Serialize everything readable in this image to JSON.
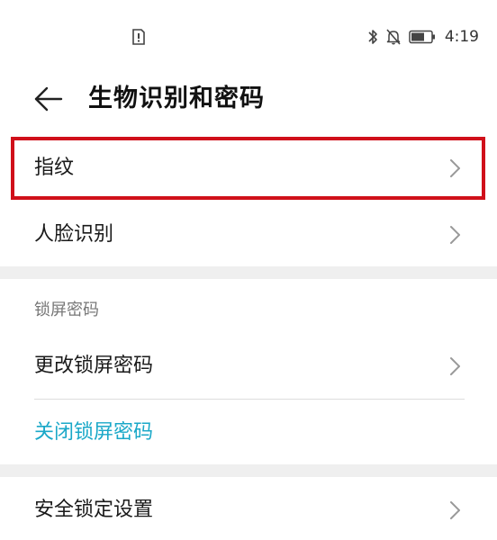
{
  "status_bar": {
    "time": "4:19",
    "icons": [
      "alert-icon",
      "bluetooth-icon",
      "bell-muted-icon",
      "battery-icon"
    ]
  },
  "header": {
    "title": "生物识别和密码"
  },
  "items": {
    "fingerprint": "指纹",
    "face": "人脸识别"
  },
  "lock_section": {
    "header": "锁屏密码",
    "change": "更改锁屏密码",
    "disable": "关闭锁屏密码"
  },
  "security": {
    "lock_settings": "安全锁定设置"
  },
  "colors": {
    "highlight": "#d0101a",
    "link": "#1aa8c8",
    "section_gap": "#efefef"
  }
}
